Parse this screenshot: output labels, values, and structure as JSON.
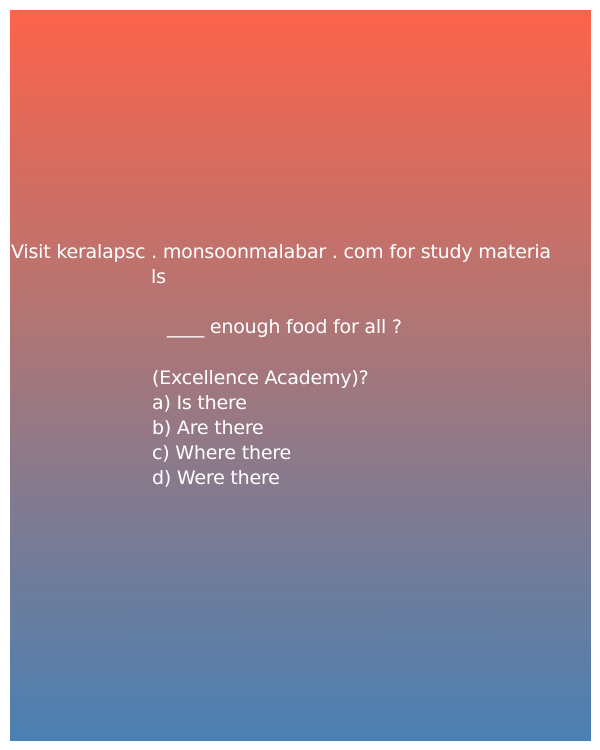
{
  "header": {
    "line1": "Visit keralapsc . monsoonmalabar . com for study materia",
    "line2": "ls"
  },
  "question": {
    "text": " ____ enough food for all ?",
    "source": "(Excellence Academy)?"
  },
  "options": [
    "a) Is there",
    "b) Are there",
    "c) Where there",
    "d) Were there"
  ],
  "colors": {
    "gradient_top": "#fd634b",
    "gradient_bottom": "#4a80b2",
    "text": "#ffffff"
  }
}
